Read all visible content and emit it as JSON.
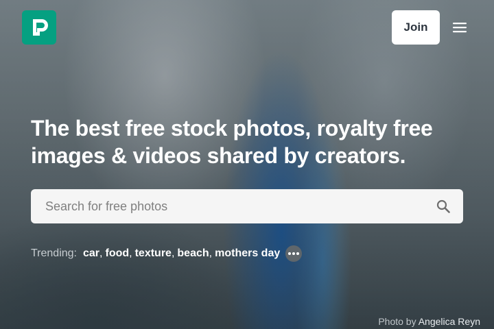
{
  "brand": {
    "logo_letter": "P",
    "accent_color": "#05a081",
    "logo_icon": "pexels-logo-icon"
  },
  "nav": {
    "join_label": "Join",
    "menu_icon": "hamburger-menu-icon"
  },
  "hero": {
    "headline": "The best free stock photos, royalty free images & videos shared by creators."
  },
  "search": {
    "placeholder": "Search for free photos",
    "value": "",
    "icon": "search-icon"
  },
  "trending": {
    "label": "Trending:",
    "items": [
      "car",
      "food",
      "texture",
      "beach",
      "mothers day"
    ],
    "more_icon": "more-horizontal-icon"
  },
  "credit": {
    "prefix": "Photo by",
    "author": "Angelica Reyn"
  }
}
